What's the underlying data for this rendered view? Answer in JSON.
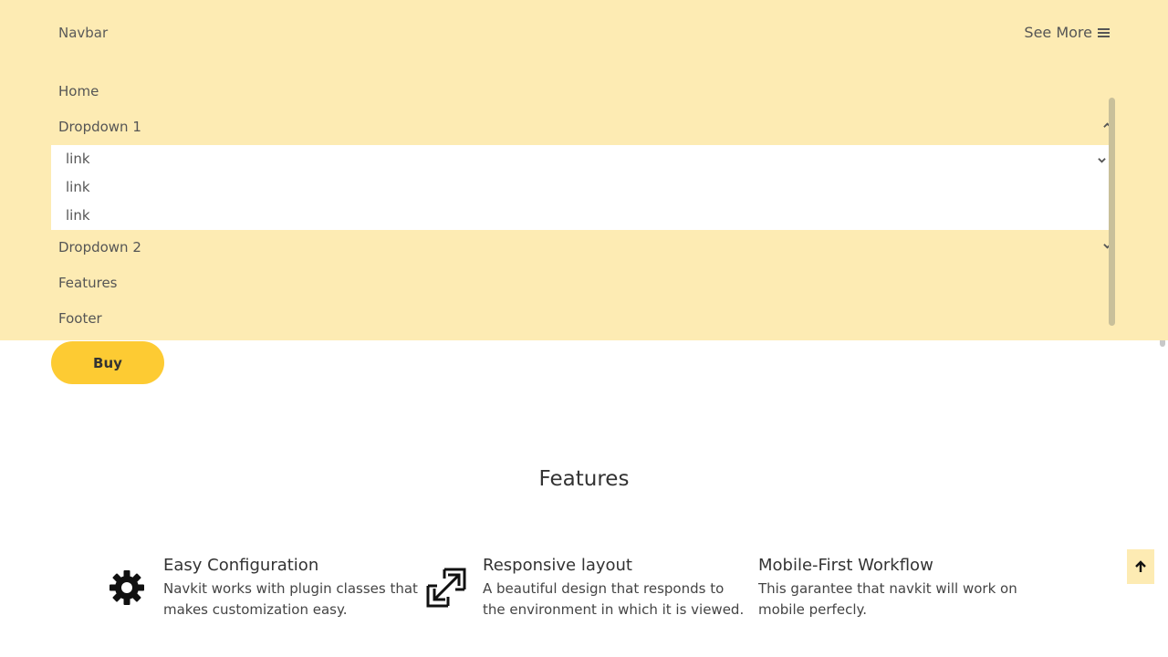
{
  "navbar": {
    "brand": "Navbar",
    "see_more": "See More",
    "menu": {
      "home": "Home",
      "dropdown1": "Dropdown 1",
      "dropdown1_links": [
        "link",
        "link",
        "link"
      ],
      "dropdown2": "Dropdown 2",
      "features": "Features",
      "footer": "Footer"
    }
  },
  "buy_label": "Buy",
  "features": {
    "title": "Features",
    "items": [
      {
        "icon": "gear-icon",
        "heading": "Easy Configuration",
        "text_line1": "Navkit works with plugin classes that",
        "text_line2": "makes customization easy."
      },
      {
        "icon": "expand-icon",
        "heading": "Responsive layout",
        "text_line1": "A beautiful design that responds to",
        "text_line2": "the environment in which it is viewed."
      },
      {
        "icon": "",
        "heading": "Mobile-First Workflow",
        "text_line1": "This garantee that navkit will work on",
        "text_line2": "mobile perfecly."
      }
    ]
  },
  "colors": {
    "navbar_bg": "#fdebb3",
    "accent": "#fdcb33"
  }
}
